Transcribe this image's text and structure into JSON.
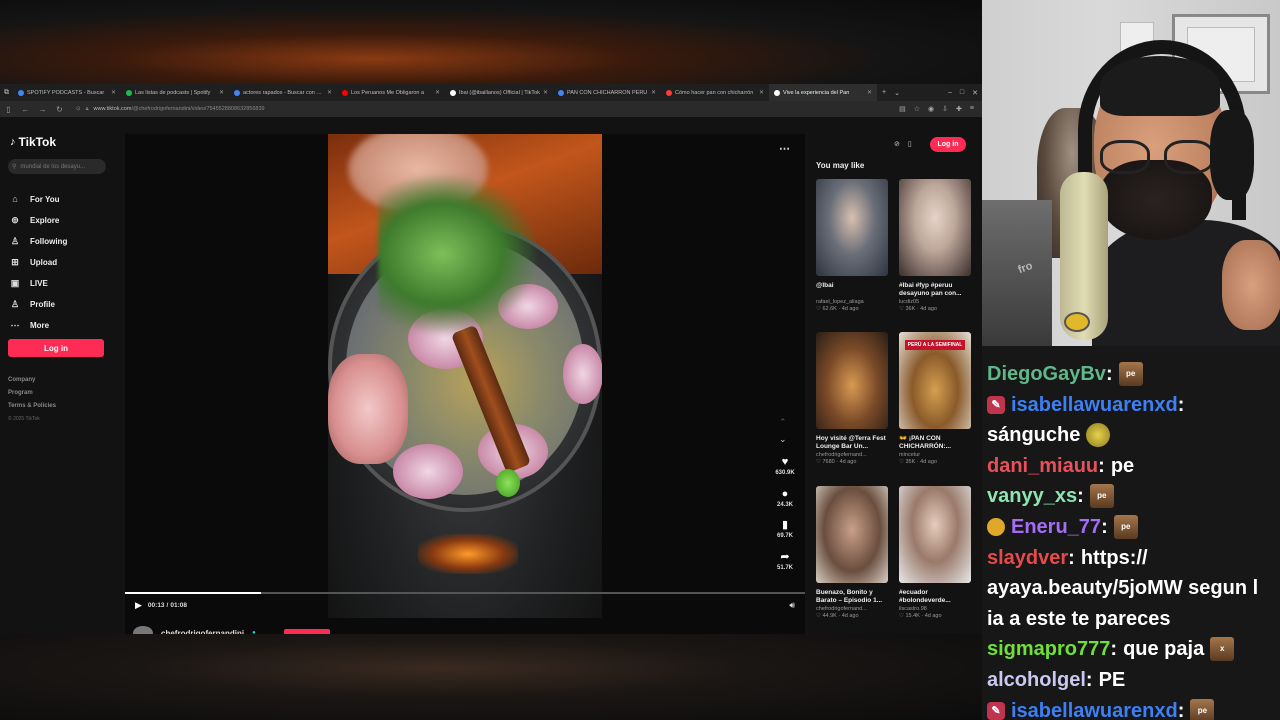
{
  "browser": {
    "tabs": [
      {
        "label": "SPOTIFY PODCASTS - Buscar",
        "color": "#4285f4",
        "active": false
      },
      {
        "label": "Las listas de podcasts | Spotify",
        "color": "#1db954",
        "active": false
      },
      {
        "label": "actores rapados - Buscar con Google",
        "color": "#4285f4",
        "active": false
      },
      {
        "label": "Los Peruanos Me Obligaron a",
        "color": "#ff0000",
        "active": false
      },
      {
        "label": "Ibai (@ibaillanos) Official | TikTok",
        "color": "#ffffff",
        "active": false
      },
      {
        "label": "PAN CON CHICHARRON PERU",
        "color": "#4285f4",
        "active": false
      },
      {
        "label": "Cómo hacer pan con chicharrón",
        "color": "#ff3b3b",
        "active": false
      },
      {
        "label": "Vive la experiencia del Pan",
        "color": "#ffffff",
        "active": true
      }
    ],
    "new_tab": "+",
    "tab_list": "⌄",
    "minimize": "–",
    "maximize": "□",
    "close": "✕",
    "url_host": "www.tiktok.com",
    "url_path": "/@chefrodrigofernandini/video/7545528808632856839"
  },
  "sidebar": {
    "logo": "TikTok",
    "search_placeholder": "mundial de los desayu...",
    "items": [
      {
        "label": "For You",
        "icon": "⌂"
      },
      {
        "label": "Explore",
        "icon": "⊚"
      },
      {
        "label": "Following",
        "icon": "♙"
      },
      {
        "label": "Upload",
        "icon": "⊞"
      },
      {
        "label": "LIVE",
        "icon": "▣"
      },
      {
        "label": "Profile",
        "icon": "♙"
      },
      {
        "label": "More",
        "icon": "⋯"
      }
    ],
    "login": "Log in",
    "footer": [
      "Company",
      "Program",
      "Terms & Policies"
    ],
    "copyright": "© 2025 TikTok"
  },
  "video": {
    "actions": [
      {
        "icon": "♥",
        "count": "630.9K"
      },
      {
        "icon": "●",
        "count": "24.3K"
      },
      {
        "icon": "▮",
        "count": "69.7K"
      },
      {
        "icon": "➦",
        "count": "51.7K"
      }
    ],
    "time_current": "00:13",
    "time_total": "01:08",
    "time_sep": "/",
    "progress": 0.2,
    "author": "chefrodrigofernandini"
  },
  "right_panel": {
    "login": "Log in",
    "title": "You may like",
    "recs": [
      {
        "title": "@Ibai",
        "author": "rafael_lopez_aliaga",
        "stats": "♡ 62.6K · 4d ago",
        "thumb": "ibai"
      },
      {
        "title": "#Ibai #fyp #peruu desayuno pan con...",
        "author": "lucdiz05",
        "stats": "♡ 36K · 4d ago",
        "thumb": "girl"
      },
      {
        "title": "Hoy visité @Terra Fest Lounge Bar Un...",
        "author": "chefrodrigofernand...",
        "stats": "♡ 7680 · 4d ago",
        "thumb": "food"
      },
      {
        "title": "👐 ¡PAN CON CHICHARRÓN:...",
        "author": "mincetur",
        "stats": "♡ 35K · 4d ago",
        "thumb": "sandwich"
      },
      {
        "title": "Buenazo, Bonito y Barato – Episodio 1...",
        "author": "chefrodrigofernand...",
        "stats": "♡ 44.9K · 4d ago",
        "thumb": "couple"
      },
      {
        "title": "#ecuador #bolondeverde...",
        "author": "ilscastro.98",
        "stats": "♡ 15.4K · 4d ago",
        "thumb": "woman"
      }
    ],
    "sandwich_banner": "PERÚ A LA SEMIFINAL"
  },
  "chat": [
    {
      "user": "DiegoGayBv",
      "color": "#5fb88a",
      "msg": "",
      "emote": "pe",
      "badge": ""
    },
    {
      "user": "isabellawuarenxd",
      "color": "#3d7ff5",
      "msg": "",
      "emote": "",
      "badge": "✎"
    },
    {
      "user": "",
      "color": "#ffffff",
      "msg": "sánguche",
      "emote": "lemon",
      "badge": ""
    },
    {
      "user": "dani_miauu",
      "color": "#e8505b",
      "msg": "pe",
      "emote": "",
      "badge": ""
    },
    {
      "user": "vanyy_xs",
      "color": "#8ee5b0",
      "msg": "",
      "emote": "pe",
      "badge": ""
    },
    {
      "user": "Eneru_77",
      "color": "#a56cf5",
      "msg": "",
      "emote": "pe",
      "badge": "gold"
    },
    {
      "user": "slaydver",
      "color": "#e64a4a",
      "msg": "https://",
      "emote": "",
      "badge": ""
    },
    {
      "user": "",
      "color": "#ffffff",
      "msg": "ayaya.beauty/5joMW segun l",
      "emote": "",
      "badge": ""
    },
    {
      "user": "",
      "color": "#ffffff",
      "msg": "ia a este te pareces",
      "emote": "",
      "badge": ""
    },
    {
      "user": "sigmapro777",
      "color": "#6fe03a",
      "msg": "que paja",
      "emote": "x",
      "badge": ""
    },
    {
      "user": "alcoholgel",
      "color": "#c8c8f0",
      "msg": "PE",
      "emote": "",
      "badge": ""
    },
    {
      "user": "isabellawuarenxd",
      "color": "#3d7ff5",
      "msg": "",
      "emote": "pe",
      "badge": "✎"
    }
  ],
  "chat_colon": ":",
  "cam": {
    "shirt_text": "fro"
  }
}
